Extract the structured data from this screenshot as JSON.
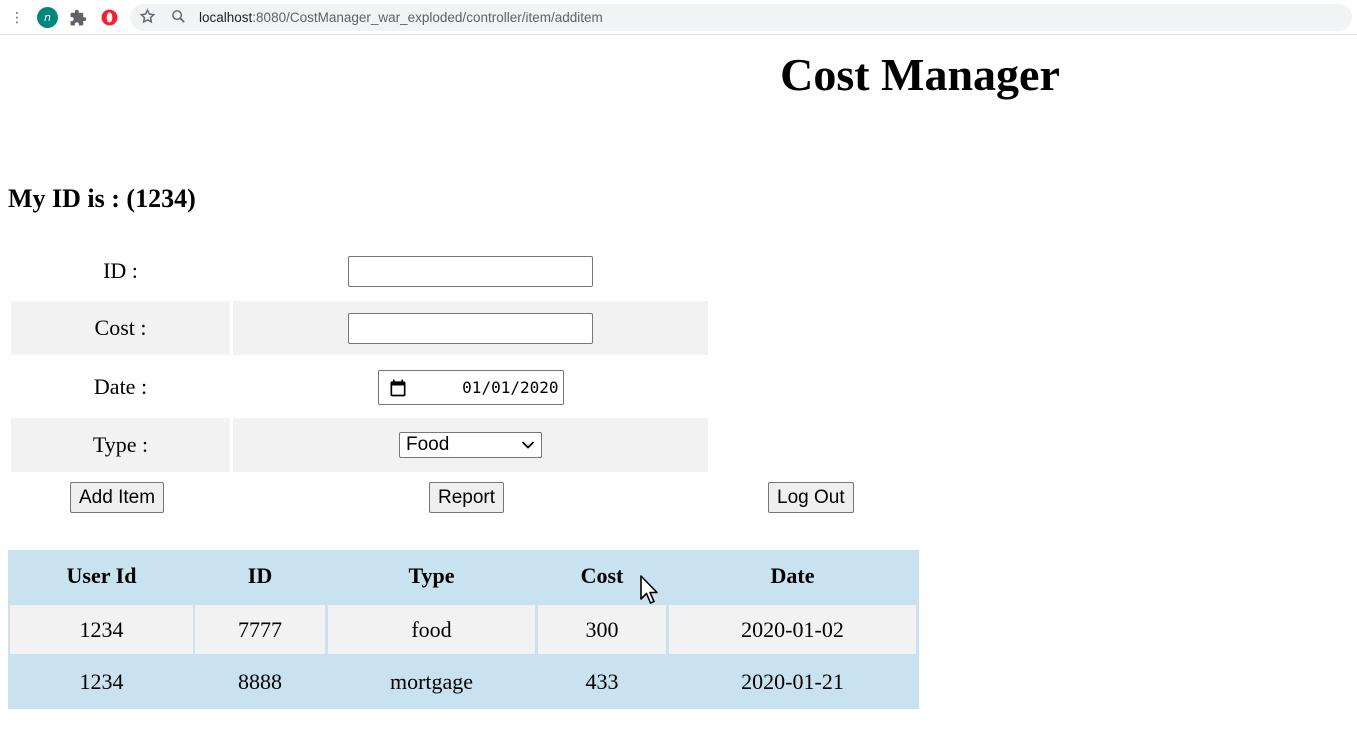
{
  "browser": {
    "ext_letter": "n",
    "url_host": "localhost",
    "url_path": ":8080/CostManager_war_exploded/controller/item/additem",
    "icons": [
      "menu-dots-icon",
      "n-extension-icon",
      "puzzle-icon",
      "opera-icon",
      "star-icon",
      "site-info-icon"
    ]
  },
  "page": {
    "title": "Cost Manager",
    "my_id_line": "My ID is : (1234)"
  },
  "form": {
    "id_label": "ID :",
    "id_value": "",
    "cost_label": "Cost :",
    "cost_value": "",
    "date_label": "Date :",
    "date_value": "01/01/2020",
    "type_label": "Type :",
    "type_value": "Food"
  },
  "buttons": {
    "add_item": "Add Item",
    "report": "Report",
    "log_out": "Log Out"
  },
  "table": {
    "headers": [
      "User Id",
      "ID",
      "Type",
      "Cost",
      "Date"
    ],
    "rows": [
      [
        "1234",
        "7777",
        "food",
        "300",
        "2020-01-02"
      ],
      [
        "1234",
        "8888",
        "mortgage",
        "433",
        "2020-01-21"
      ]
    ]
  },
  "colors": {
    "table_header_bg": "#c9e2ef",
    "row_alt_bg": "#f2f2f2",
    "ext_badge": "#00897b",
    "opera_red": "#ff1b2d"
  }
}
